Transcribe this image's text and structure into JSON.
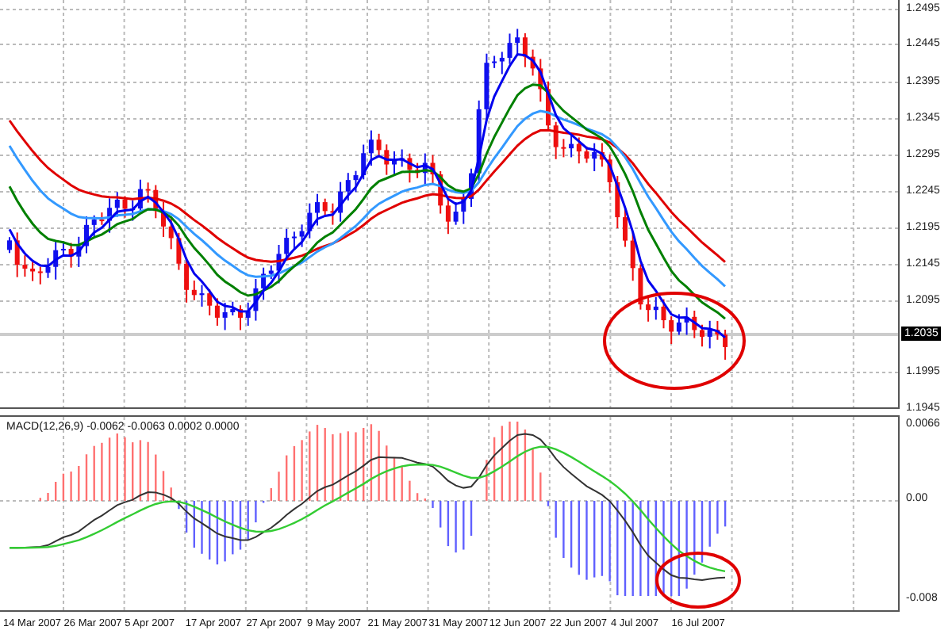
{
  "price_axis": {
    "labels": [
      "1.2495",
      "1.2445",
      "1.2395",
      "1.2345",
      "1.2295",
      "1.2245",
      "1.2195",
      "1.2145",
      "1.2095",
      "1.1995",
      "1.1945"
    ],
    "current_price": "1.2035"
  },
  "macd_panel": {
    "title": "MACD(12,26,9) -0.0062 -0.0063 0.0002 0.0000",
    "axis_labels": [
      "0.0066",
      "0.00",
      "-0.008"
    ]
  },
  "time_axis": {
    "labels": [
      "14 Mar 2007",
      "26 Mar 2007",
      "5 Apr 2007",
      "17 Apr 2007",
      "27 Apr 2007",
      "9 May 2007",
      "21 May 2007",
      "31 May 2007",
      "12 Jun 2007",
      "22 Jun 2007",
      "4 Jul 2007",
      "16 Jul 2007"
    ]
  }
}
